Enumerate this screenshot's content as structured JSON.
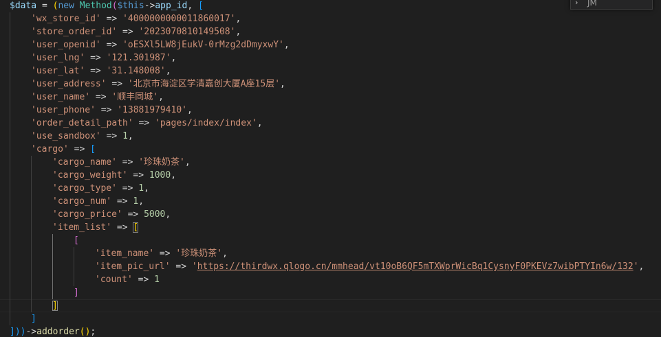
{
  "editor": {
    "find_widget": {
      "chevron": "›",
      "text": "JM"
    },
    "code": {
      "var": "$data",
      "eq": " = ",
      "open_paren": "(",
      "new_kw": "new",
      "class_name": "Method",
      "this": "$this",
      "arrow": "->",
      "prop": "app_id",
      "comma": ", ",
      "open_bracket": "[",
      "pairs": [
        {
          "key": "'wx_store_id'",
          "value": "'4000000000011860017'"
        },
        {
          "key": "'store_order_id'",
          "value": "'2023070810149508'"
        },
        {
          "key": "'user_openid'",
          "value": "'oESXl5LW8jEukV-0rMzg2dDmyxwY'"
        },
        {
          "key": "'user_lng'",
          "value": "'121.301987'"
        },
        {
          "key": "'user_lat'",
          "value": "'31.148008'"
        },
        {
          "key": "'user_address'",
          "value": "'北京市海淀区学清嘉创大厦A座15层'"
        },
        {
          "key": "'user_name'",
          "value": "'顺丰同城'"
        },
        {
          "key": "'user_phone'",
          "value": "'13881979410'"
        },
        {
          "key": "'order_detail_path'",
          "value": "'pages/index/index'"
        },
        {
          "key": "'use_sandbox'",
          "value": "1"
        }
      ],
      "cargo_key": "'cargo'",
      "cargo_pairs": [
        {
          "key": "'cargo_name'",
          "value": "'珍珠奶茶'"
        },
        {
          "key": "'cargo_weight'",
          "value": "1000"
        },
        {
          "key": "'cargo_type'",
          "value": "1"
        },
        {
          "key": "'cargo_num'",
          "value": "1"
        },
        {
          "key": "'cargo_price'",
          "value": "5000"
        }
      ],
      "item_list_key": "'item_list'",
      "item_pairs": [
        {
          "key": "'item_name'",
          "value": "'珍珠奶茶'"
        },
        {
          "key": "'item_pic_url'",
          "value_quote_open": "'",
          "url": "https://thirdwx.qlogo.cn/mmhead/vt10oB6QF5mTXWprWicBq1CysnyF0PKEVz7wibPTYIn6w/132",
          "value_quote_close": "'"
        },
        {
          "key": "'count'",
          "value": "1"
        }
      ],
      "fat_arrow": " => ",
      "close_bracket": "]",
      "final_close": "]))",
      "method_call": "addorder",
      "call_parens": "()",
      "semicolon": ";"
    }
  }
}
